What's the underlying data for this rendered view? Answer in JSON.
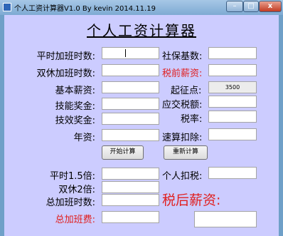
{
  "window": {
    "title": "个人工资计算器V1.0 By kevin 2014.11.19",
    "min_label": "–",
    "max_label": "□",
    "close_label": "x"
  },
  "heading": "个人工资计算器",
  "labels": {
    "overtime_weekday": "平时加班时数:",
    "overtime_weekend": "双休加班时数:",
    "base_salary": "基本薪资:",
    "skill_bonus": "技能奖金:",
    "performance_bonus": "技效奖金:",
    "seniority": "年资:",
    "social_security_base": "社保基数:",
    "pretax_salary": "税前薪资:",
    "threshold": "起征点:",
    "tax_payable": "应交税额:",
    "tax_rate": "税率:",
    "quick_deduction": "速算扣除:",
    "weekday_1_5x": "平时1.5倍:",
    "weekend_2x": "双休2倍:",
    "total_overtime_hours": "总加班时数:",
    "total_overtime_pay": "总加班费:",
    "personal_tax": "个人扣税:",
    "after_tax_salary": "税后薪资:"
  },
  "inputs": {
    "threshold_value": "3500"
  },
  "buttons": {
    "calculate": "开始计算",
    "reset": "重新计算"
  }
}
